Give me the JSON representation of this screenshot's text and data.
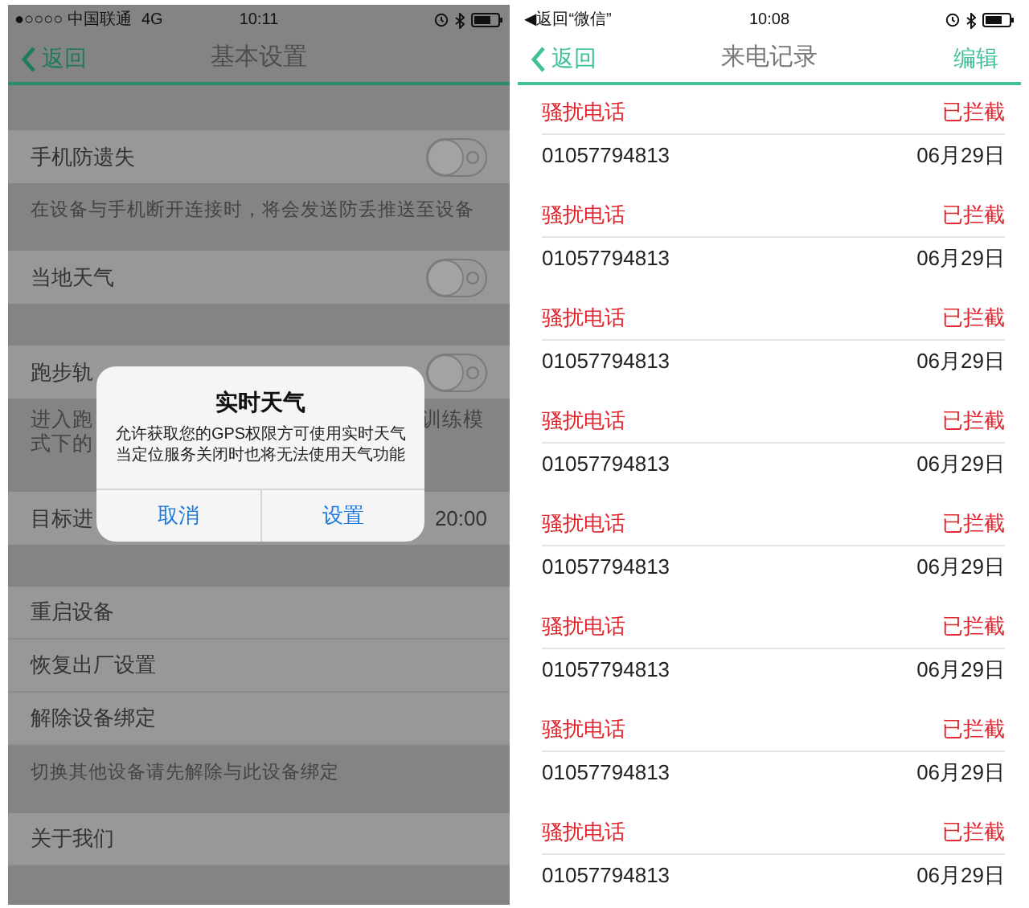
{
  "left_phone": {
    "status_bar": {
      "carrier": "●○○○○ 中国联通",
      "network": "4G",
      "time": "10:11"
    },
    "nav_bar": {
      "back": "返回",
      "title": "基本设置"
    },
    "groups": [
      [
        {
          "kind": "toggle",
          "label": "手机防遗失",
          "on": false
        },
        {
          "kind": "note",
          "text": "在设备与手机断开连接时，将会发送防丢推送至设备"
        }
      ],
      [
        {
          "kind": "toggle",
          "label": "当地天气",
          "on": false
        }
      ],
      [
        {
          "kind": "toggle",
          "label": "跑步轨",
          "on": false
        },
        {
          "kind": "note_split",
          "left": [
            "进入跑",
            "式下的"
          ],
          "right": "训练模"
        }
      ],
      [
        {
          "kind": "value",
          "label": "目标进",
          "value": "20:00"
        }
      ],
      [
        {
          "kind": "link",
          "label": "重启设备"
        },
        {
          "kind": "link",
          "label": "恢复出厂设置"
        },
        {
          "kind": "link",
          "label": "解除设备绑定"
        },
        {
          "kind": "note",
          "text": "切换其他设备请先解除与此设备绑定"
        }
      ],
      [
        {
          "kind": "link",
          "label": "关于我们"
        }
      ]
    ],
    "dialog": {
      "title": "实时天气",
      "message": [
        "允许获取您的GPS权限方可使用实时天气",
        "当定位服务关闭时也将无法使用天气功能"
      ],
      "buttons": [
        "取消",
        "设置"
      ]
    }
  },
  "right_phone": {
    "status_bar": {
      "back_app": "◀返回“微信”",
      "time": "10:08"
    },
    "nav_bar": {
      "back": "返回",
      "title": "来电记录",
      "action": "编辑"
    },
    "records": [
      {
        "tag": "骚扰电话",
        "status": "已拦截",
        "number": "01057794813",
        "date": "06月29日"
      },
      {
        "tag": "骚扰电话",
        "status": "已拦截",
        "number": "01057794813",
        "date": "06月29日"
      },
      {
        "tag": "骚扰电话",
        "status": "已拦截",
        "number": "01057794813",
        "date": "06月29日"
      },
      {
        "tag": "骚扰电话",
        "status": "已拦截",
        "number": "01057794813",
        "date": "06月29日"
      },
      {
        "tag": "骚扰电话",
        "status": "已拦截",
        "number": "01057794813",
        "date": "06月29日"
      },
      {
        "tag": "骚扰电话",
        "status": "已拦截",
        "number": "01057794813",
        "date": "06月29日"
      },
      {
        "tag": "骚扰电话",
        "status": "已拦截",
        "number": "01057794813",
        "date": "06月29日"
      },
      {
        "tag": "骚扰电话",
        "status": "已拦截",
        "number": "01057794813",
        "date": "06月29日"
      }
    ]
  }
}
